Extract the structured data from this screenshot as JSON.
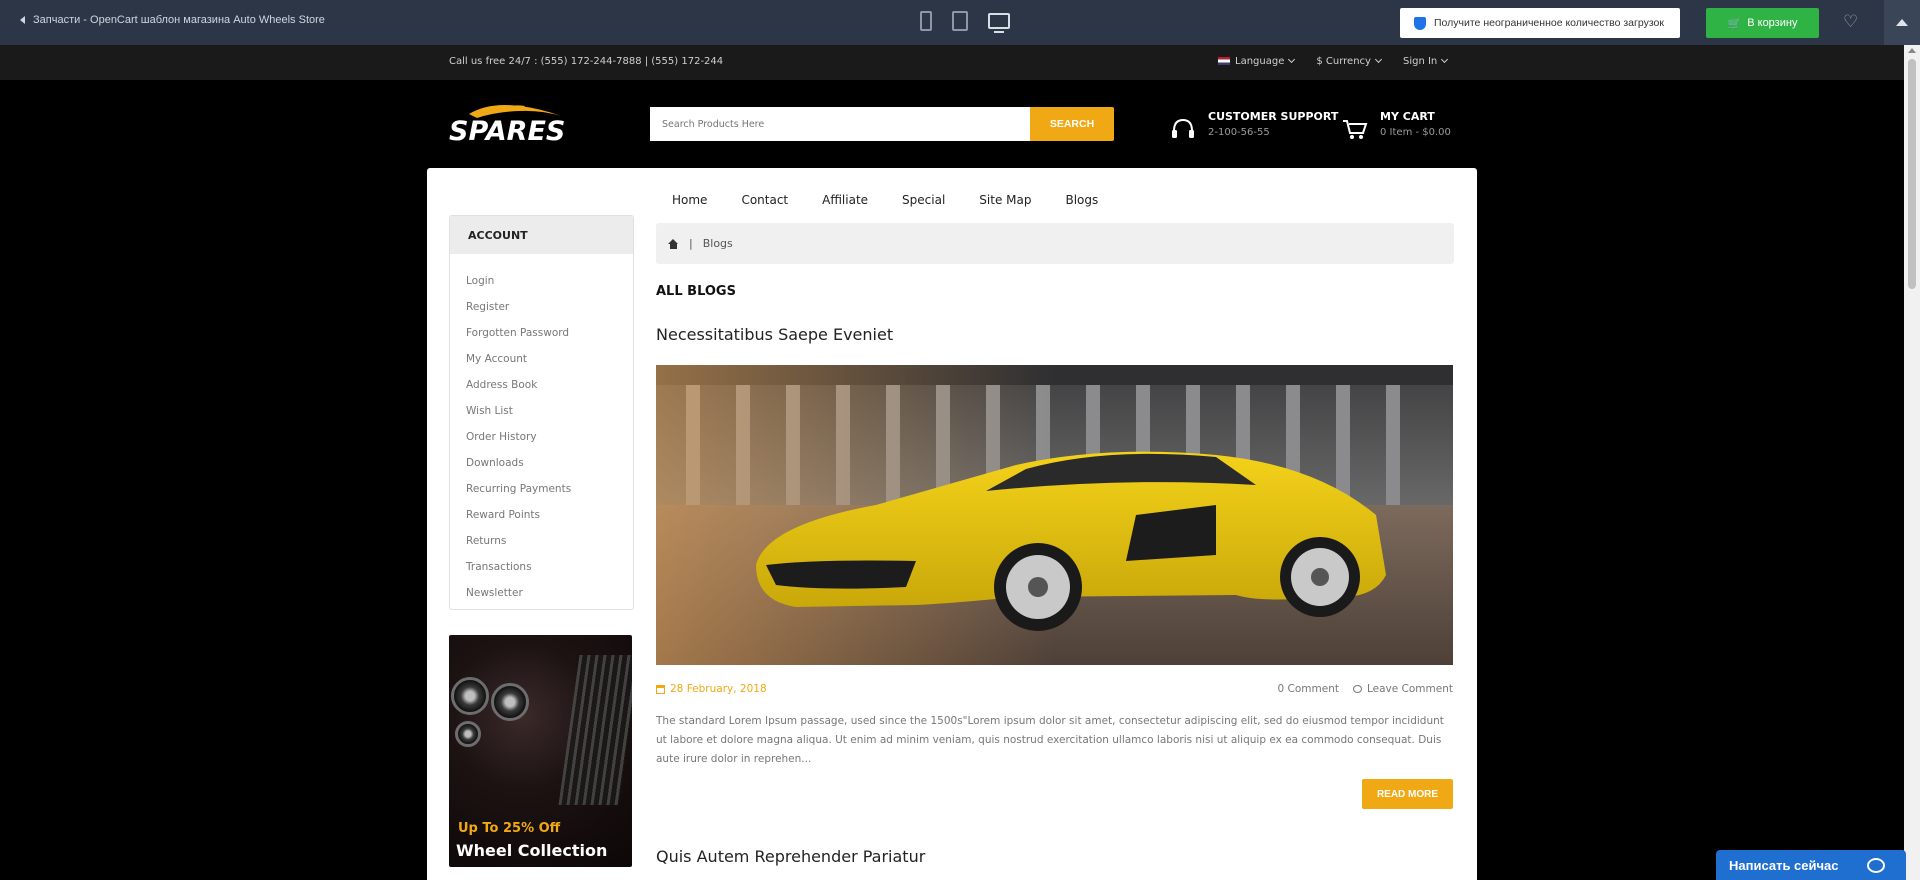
{
  "preview_bar": {
    "back_label": "Запчасти - OpenCart шаблон магазина Auto Wheels Store",
    "promo_text": "Получите неограниченное количество загрузок",
    "cart_button": "В корзину"
  },
  "topbar": {
    "call_text": "Call us free 24/7 : (555) 172-244-7888 | (555) 172-244",
    "language": "Language",
    "currency": "$ Currency",
    "signin": "Sign In"
  },
  "header": {
    "logo_text": "SPARES",
    "search_placeholder": "Search Products Here",
    "search_button": "SEARCH",
    "support_title": "CUSTOMER SUPPORT",
    "support_phone": "2-100-56-55",
    "cart_title": "MY CART",
    "cart_summary": "0 Item - $0.00"
  },
  "nav": [
    "Home",
    "Contact",
    "Affiliate",
    "Special",
    "Site Map",
    "Blogs"
  ],
  "account": {
    "heading": "ACCOUNT",
    "items": [
      "Login",
      "Register",
      "Forgotten Password",
      "My Account",
      "Address Book",
      "Wish List",
      "Order History",
      "Downloads",
      "Recurring Payments",
      "Reward Points",
      "Returns",
      "Transactions",
      "Newsletter"
    ]
  },
  "banner": {
    "line1": "Up To 25% Off",
    "line2": "Wheel Collection"
  },
  "breadcrumb": {
    "separator": "|",
    "current": "Blogs"
  },
  "blog": {
    "heading": "ALL BLOGS",
    "posts": [
      {
        "title": "Necessitatibus Saepe Eveniet",
        "date": "28 February, 2018",
        "comments": "0 Comment",
        "leave_comment": "Leave Comment",
        "excerpt": "The standard Lorem Ipsum passage, used since the 1500s\"Lorem ipsum dolor sit amet, consectetur adipiscing elit, sed do eiusmod tempor incididunt ut labore et dolore magna aliqua. Ut enim ad minim veniam, quis nostrud exercitation ullamco laboris nisi ut aliquip ex ea commodo consequat. Duis aute irure dolor in reprehen...",
        "read_more": "READ MORE"
      },
      {
        "title": "Quis Autem Reprehender Pariatur"
      }
    ]
  },
  "chat": {
    "label": "Написать сейчас"
  },
  "colors": {
    "accent": "#f0a814",
    "preview_bg": "#2c3646",
    "cart_green": "#2fb344",
    "chat_blue": "#1f6fd1"
  }
}
